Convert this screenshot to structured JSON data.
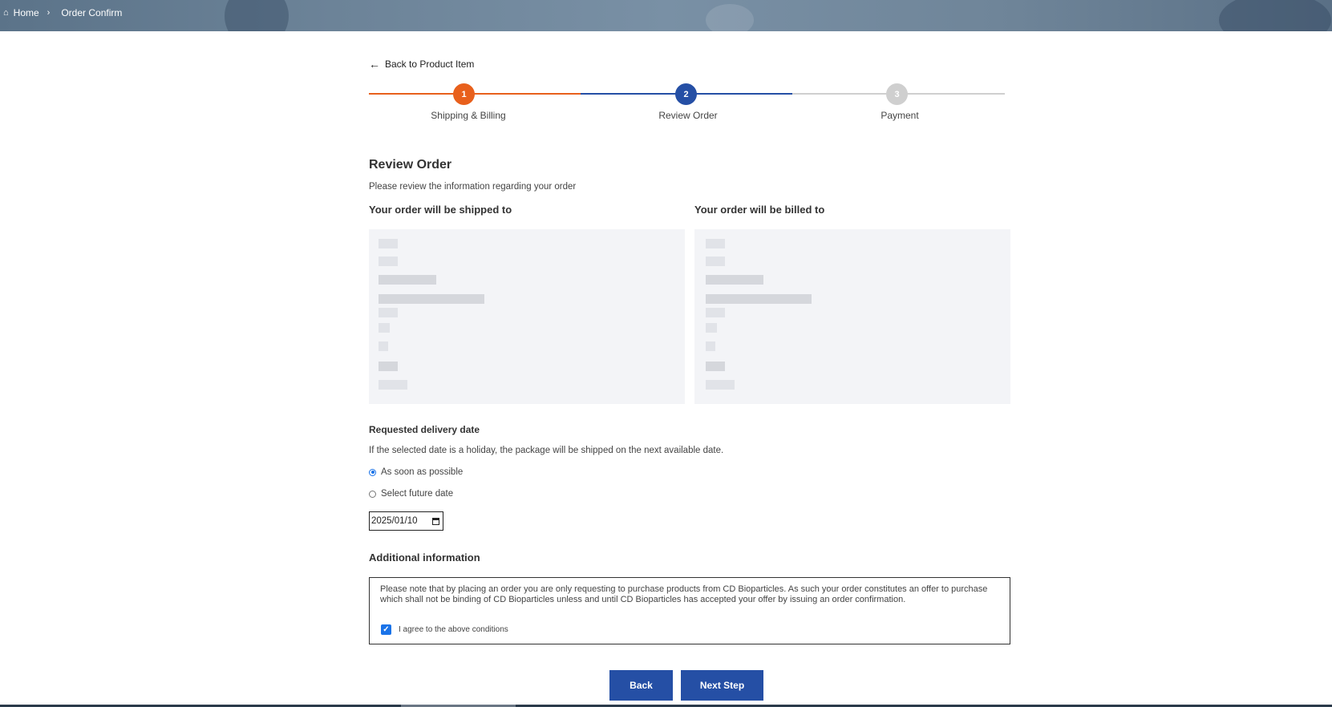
{
  "breadcrumb": {
    "home_label": "Home",
    "current_label": "Order Confirm",
    "home_icon": "home-icon"
  },
  "back_link": {
    "label": "Back to Product Item",
    "icon": "arrow-left-icon"
  },
  "stepper": {
    "steps": [
      {
        "number": "1",
        "label": "Shipping & Billing",
        "color": "#e8601c",
        "state": "complete"
      },
      {
        "number": "2",
        "label": "Review Order",
        "color": "#254fa5",
        "state": "current"
      },
      {
        "number": "3",
        "label": "Payment",
        "color": "#cfcfcf",
        "state": "upcoming"
      }
    ]
  },
  "review": {
    "title": "Review Order",
    "subtitle": "Please review the information regarding your order",
    "shipped_heading": "Your order will be shipped to",
    "billed_heading": "Your order will be billed to"
  },
  "delivery": {
    "title": "Requested delivery date",
    "note": "If the selected date is a holiday, the package will be shipped on the next available date.",
    "options": [
      {
        "label": "As soon as possible",
        "selected": true
      },
      {
        "label": "Select future date",
        "selected": false
      }
    ],
    "date_value": "2025/01/10"
  },
  "additional": {
    "title": "Additional information",
    "notice": "Please note that by placing an order you are only requesting to purchase products from CD Bioparticles. As such your order constitutes an offer to purchase which shall not be binding of CD Bioparticles unless and until CD Bioparticles has accepted your offer by issuing an order confirmation.",
    "agree_label": "I agree to the above conditions",
    "agree_checked": true
  },
  "buttons": {
    "back_label": "Back",
    "next_label": "Next Step"
  },
  "colors": {
    "primary": "#254fa5",
    "accent": "#e8601c",
    "inactive": "#cfcfcf"
  }
}
